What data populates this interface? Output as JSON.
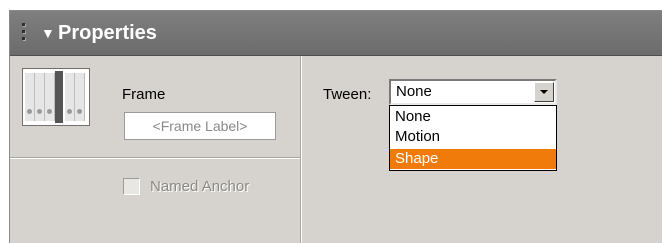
{
  "panel": {
    "title": "Properties",
    "collapse_icon": "triangle-down-icon",
    "grip_icon": "drag-grip-icon"
  },
  "frame": {
    "label": "Frame",
    "frame_label_placeholder": "<Frame Label>",
    "named_anchor_label": "Named Anchor",
    "named_anchor_checked": false
  },
  "tween": {
    "label": "Tween:",
    "selected": "None",
    "options": [
      "None",
      "Motion",
      "Shape"
    ],
    "highlighted": "Shape",
    "highlight_color": "#f07a0a"
  },
  "colors": {
    "title_bar": "#737373",
    "panel_bg": "#d6d3ce"
  }
}
